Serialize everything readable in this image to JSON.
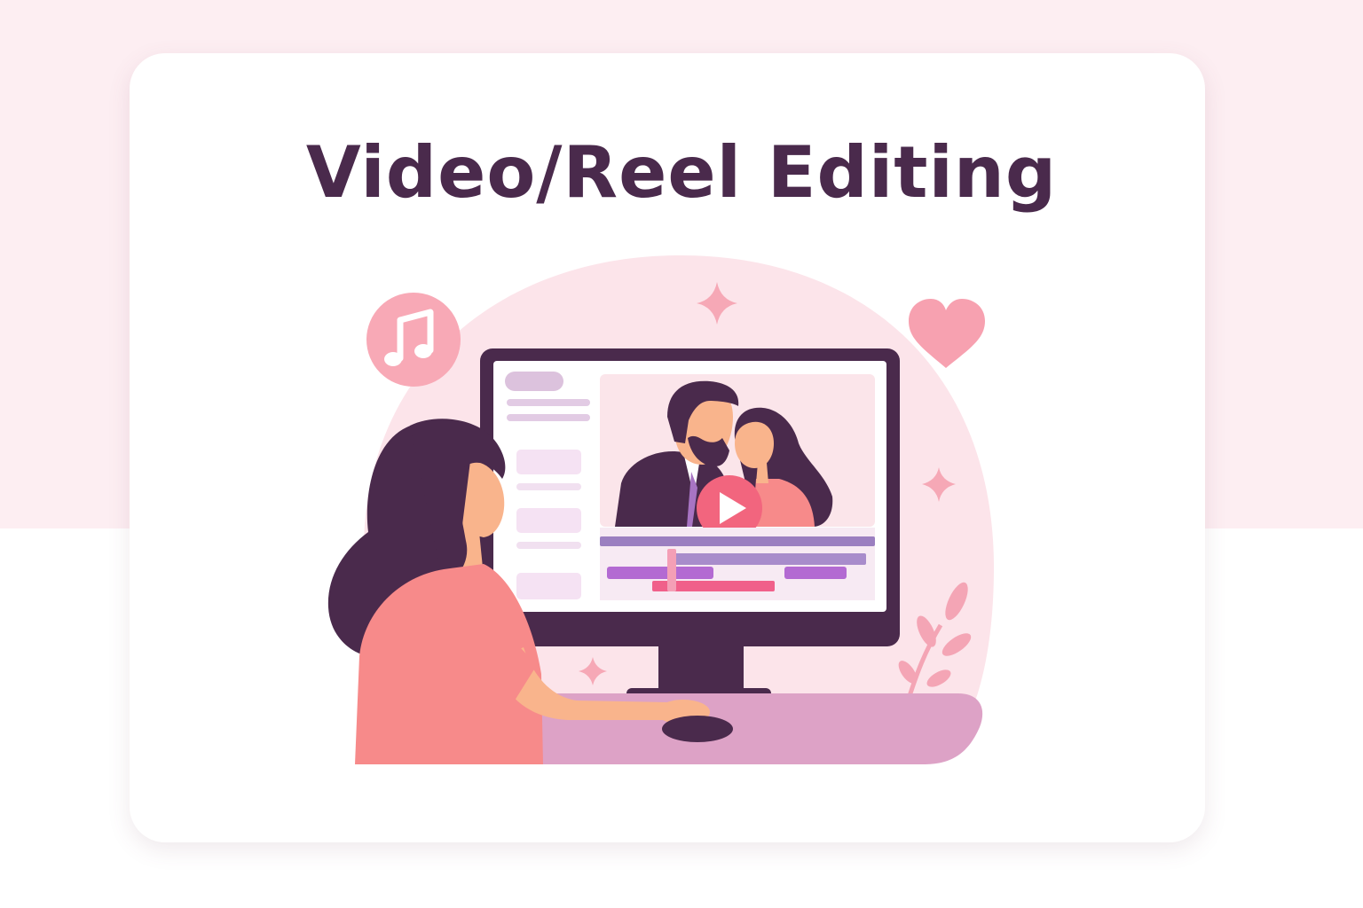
{
  "title": "Video/Reel Editing",
  "colors": {
    "background_band": "#fdeef2",
    "card": "#ffffff",
    "title": "#4a2a4c",
    "blob": "#fce4ea",
    "accent_pink": "#f7a1b0",
    "monitor_frame": "#4a2a4c",
    "play_button": "#f2657e",
    "timeline_purple": "#9b7fc0",
    "timeline_magenta": "#b36ad2",
    "timeline_pink": "#f0608a",
    "desk": "#dda2c6",
    "hair": "#4a2a4c",
    "shirt": "#f78a8a",
    "skin": "#f9b48c"
  },
  "icons": [
    "music-note-icon",
    "heart-icon",
    "sparkle-icon",
    "play-icon",
    "plant-icon"
  ]
}
